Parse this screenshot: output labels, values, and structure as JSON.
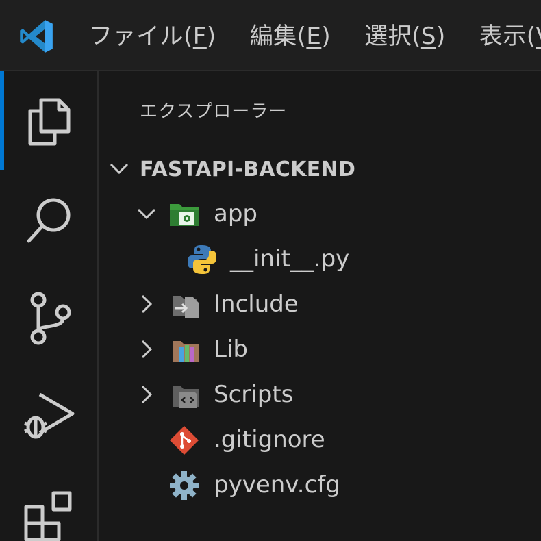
{
  "menubar": {
    "items": [
      {
        "text": "ファイル(",
        "mnemonic": "F",
        "close": ")"
      },
      {
        "text": "編集(",
        "mnemonic": "E",
        "close": ")"
      },
      {
        "text": "選択(",
        "mnemonic": "S",
        "close": ")"
      },
      {
        "text": "表示(",
        "mnemonic": "V",
        "close": ")"
      }
    ]
  },
  "activitybar": {
    "items": [
      "explorer-icon",
      "search-icon",
      "source-control-icon",
      "run-debug-icon",
      "extensions-icon"
    ],
    "active": "explorer-icon",
    "accent": "#0078d4"
  },
  "sidebar": {
    "title": "エクスプローラー",
    "root": {
      "label": "FASTAPI-BACKEND",
      "expanded": true
    },
    "tree": [
      {
        "label": "app",
        "type": "folder",
        "icon": "folder-app-icon",
        "expanded": true,
        "depth": 1
      },
      {
        "label": "__init__.py",
        "type": "file",
        "icon": "python-icon",
        "depth": 2
      },
      {
        "label": "Include",
        "type": "folder",
        "icon": "folder-include-icon",
        "expanded": false,
        "depth": 1
      },
      {
        "label": "Lib",
        "type": "folder",
        "icon": "folder-lib-icon",
        "expanded": false,
        "depth": 1
      },
      {
        "label": "Scripts",
        "type": "folder",
        "icon": "folder-scripts-icon",
        "expanded": false,
        "depth": 1
      },
      {
        "label": ".gitignore",
        "type": "file",
        "icon": "git-icon",
        "depth": 1
      },
      {
        "label": "pyvenv.cfg",
        "type": "file",
        "icon": "gear-icon",
        "depth": 1
      }
    ]
  },
  "colors": {
    "background": "#181818",
    "text": "#cccccc",
    "icon": "#cccccc"
  }
}
